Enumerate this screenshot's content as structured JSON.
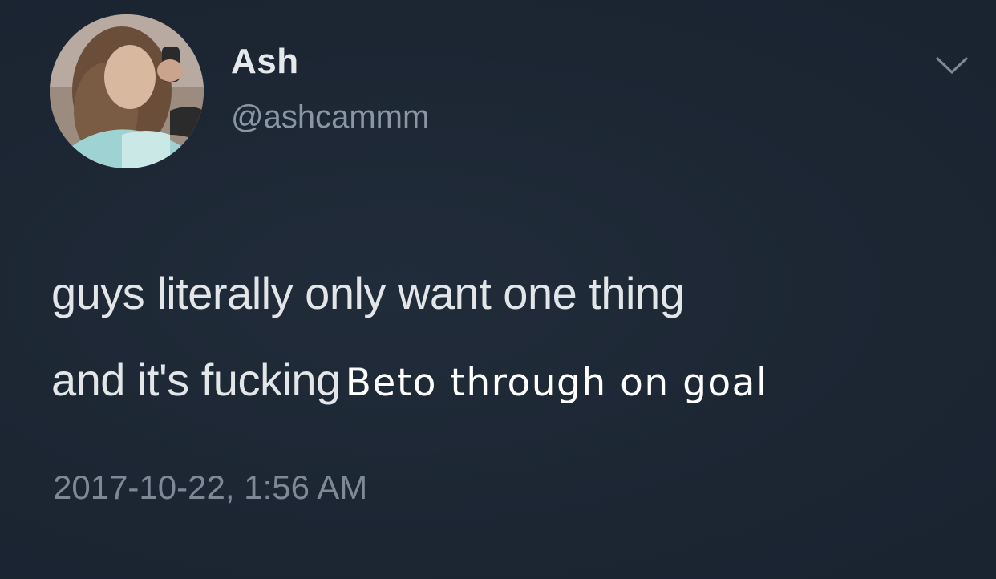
{
  "tweet": {
    "display_name": "Ash",
    "handle": "@ashcammm",
    "text_line1": "guys literally only want one thing",
    "text_line2": "and it's fucking",
    "overlay_text": "Beto through on goal",
    "timestamp": "2017-10-22, 1:56 AM",
    "avatar_icon": "profile-photo",
    "menu_icon": "chevron-down-icon"
  },
  "colors": {
    "background": "#1d2734",
    "name": "#e6e9ec",
    "handle": "#8a96a3",
    "timestamp": "#7d8995"
  }
}
